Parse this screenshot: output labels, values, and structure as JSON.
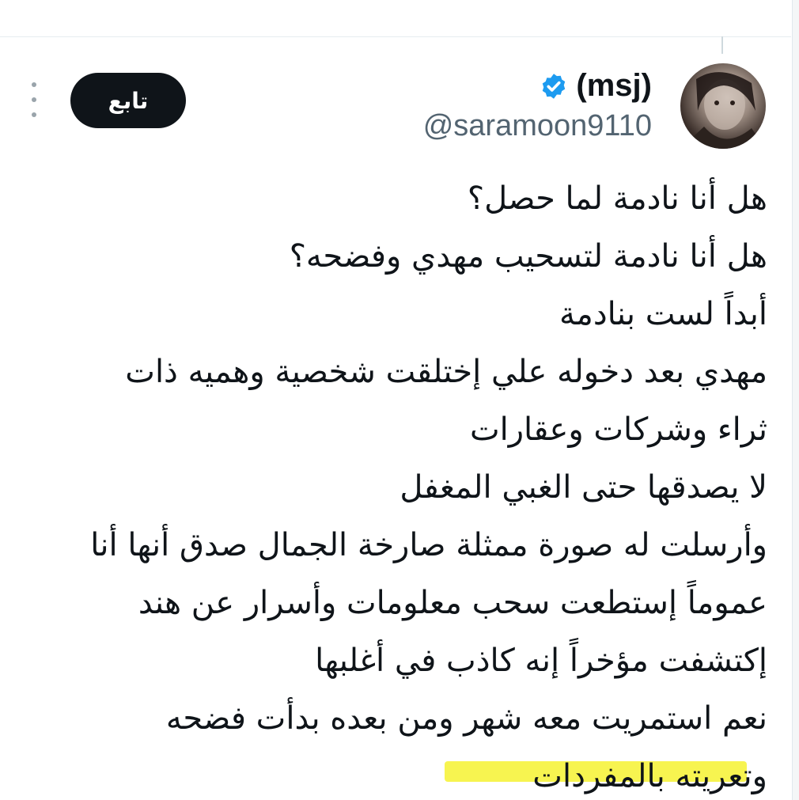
{
  "post": {
    "display_name": "(msj)",
    "handle": "@saramoon9110",
    "follow_label": "تابع",
    "lines": [
      "هل أنا نادمة لما حصل؟",
      "هل أنا نادمة لتسحيب مهدي وفضحه؟",
      "أبداً لست بنادمة",
      "مهدي بعد دخوله علي إختلقت شخصية وهميه ذات",
      "ثراء وشركات وعقارات",
      "لا يصدقها حتى الغبي المغفل",
      "وأرسلت له صورة ممثلة صارخة الجمال صدق أنها أنا",
      "عموماً إستطعت سحب معلومات وأسرار عن هند",
      "إكتشفت مؤخراً إنه كاذب في أغلبها",
      "نعم استمريت معه شهر ومن بعده بدأت فضحه",
      "وتعريته بالمفردات"
    ]
  },
  "icons": {
    "verified": "verified-badge-icon",
    "more": "more-options-icon",
    "avatar": "profile-avatar"
  },
  "colors": {
    "text": "#0f1419",
    "secondary": "#536471",
    "verified": "#1d9bf0",
    "follow_bg": "#0f1419",
    "highlight": "#f6f231"
  }
}
